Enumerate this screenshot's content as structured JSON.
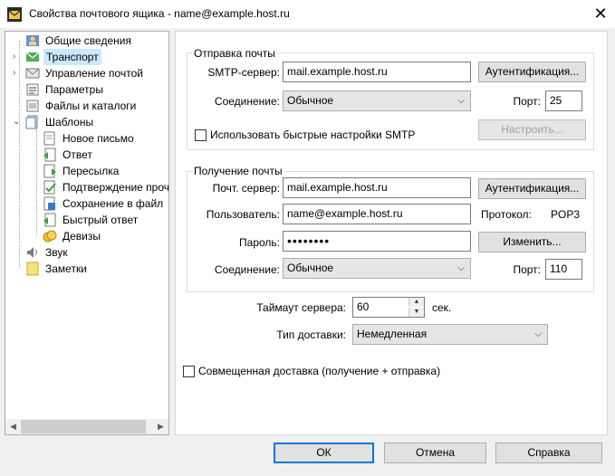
{
  "window": {
    "title": "Свойства почтового ящика - name@example.host.ru",
    "close_glyph": "✕"
  },
  "tree": {
    "items": [
      {
        "label": "Общие сведения",
        "icon": "general-info-icon"
      },
      {
        "label": "Транспорт",
        "icon": "transport-icon",
        "selected": true
      },
      {
        "label": "Управление почтой",
        "icon": "mail-management-icon"
      },
      {
        "label": "Параметры",
        "icon": "parameters-icon"
      },
      {
        "label": "Файлы и каталоги",
        "icon": "folders-icon"
      },
      {
        "label": "Шаблоны",
        "icon": "templates-icon",
        "expanded": true
      },
      {
        "label": "Новое письмо",
        "icon": "new-letter-icon"
      },
      {
        "label": "Ответ",
        "icon": "reply-icon"
      },
      {
        "label": "Пересылка",
        "icon": "forward-icon"
      },
      {
        "label": "Подтверждение проч",
        "icon": "confirmation-icon"
      },
      {
        "label": "Сохранение в файл",
        "icon": "save-to-file-icon"
      },
      {
        "label": "Быстрый ответ",
        "icon": "quick-reply-icon"
      },
      {
        "label": "Девизы",
        "icon": "mottos-icon"
      },
      {
        "label": "Звук",
        "icon": "sound-icon"
      },
      {
        "label": "Заметки",
        "icon": "notes-icon"
      }
    ]
  },
  "send": {
    "group_title": "Отправка почты",
    "smtp_label": "SMTP-сервер:",
    "smtp_value": "mail.example.host.ru",
    "auth_button": "Аутентификация...",
    "connection_label": "Соединение:",
    "connection_value": "Обычное",
    "port_label": "Порт:",
    "port_value": "25",
    "quick_smtp_label": "Использовать быстрые настройки SMTP",
    "quick_smtp_checked": false,
    "configure_button": "Настроить..."
  },
  "receive": {
    "group_title": "Получение почты",
    "server_label": "Почт. сервер:",
    "server_value": "mail.example.host.ru",
    "auth_button": "Аутентификация...",
    "user_label": "Пользователь:",
    "user_value": "name@example.host.ru",
    "protocol_label": "Протокол:",
    "protocol_value": "POP3",
    "password_label": "Пароль:",
    "password_value": "••••••••",
    "change_button": "Изменить...",
    "connection_label": "Соединение:",
    "connection_value": "Обычное",
    "port_label": "Порт:",
    "port_value": "110"
  },
  "timeout": {
    "label": "Таймаут сервера:",
    "value": "60",
    "unit": "сек."
  },
  "delivery": {
    "label": "Тип доставки:",
    "value": "Немедленная"
  },
  "combined": {
    "label": "Совмещенная доставка (получение + отправка)",
    "checked": false
  },
  "buttons": {
    "ok": "ОК",
    "cancel": "Отмена",
    "help": "Справка"
  }
}
